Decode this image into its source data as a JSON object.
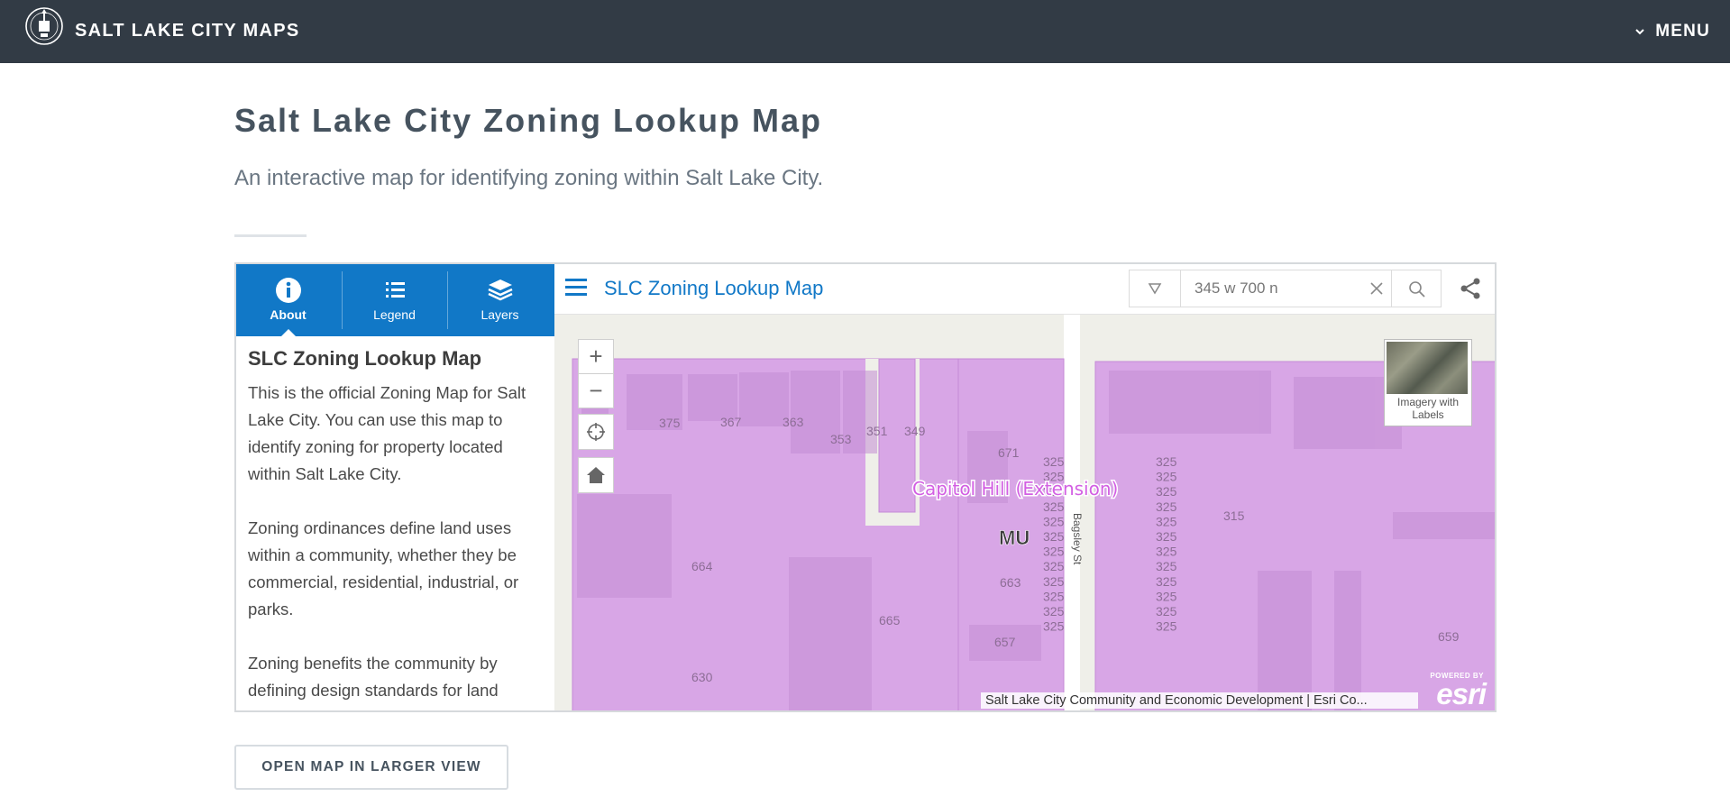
{
  "header": {
    "site_title": "SALT LAKE CITY MAPS",
    "menu_label": "MENU"
  },
  "page": {
    "title": "Salt Lake City Zoning Lookup Map",
    "subtitle": "An interactive map for identifying zoning within Salt Lake City.",
    "open_button_label": "OPEN MAP IN LARGER VIEW"
  },
  "side_panel": {
    "tabs": [
      {
        "label": "About",
        "icon": "info-icon",
        "active": true
      },
      {
        "label": "Legend",
        "icon": "list-icon",
        "active": false
      },
      {
        "label": "Layers",
        "icon": "layers-icon",
        "active": false
      }
    ],
    "title": "SLC Zoning Lookup Map",
    "paragraphs": [
      "This is the official Zoning Map for Salt Lake City. You can use this map to identify zoning for property located within Salt Lake City.",
      "Zoning ordinances define land uses within a community, whether they be commercial, residential, industrial, or parks.",
      "Zoning benefits the community by defining design standards for land"
    ]
  },
  "map": {
    "title": "SLC Zoning Lookup Map",
    "search_value": "345 w 700 n",
    "zoom_in": "+",
    "zoom_out": "−",
    "basemap_label": "Imagery with Labels",
    "attribution": "Salt Lake City Community and Economic Development | Esri Co...",
    "esri_powered": "POWERED BY",
    "esri_logo": "esri",
    "zone_label": "MU",
    "district_label": "Capitol Hill (Extension)",
    "street_label": "Bagsley St",
    "parcel_numbers": [
      "375",
      "367",
      "363",
      "353",
      "351",
      "349",
      "671",
      "664",
      "663",
      "665",
      "657",
      "630",
      "315",
      "659"
    ],
    "colors": {
      "zone_fill": "#d8a6e6",
      "zone_stroke": "#c58ad6",
      "district_label": "#d35fe3",
      "accent": "#1178c7"
    }
  }
}
